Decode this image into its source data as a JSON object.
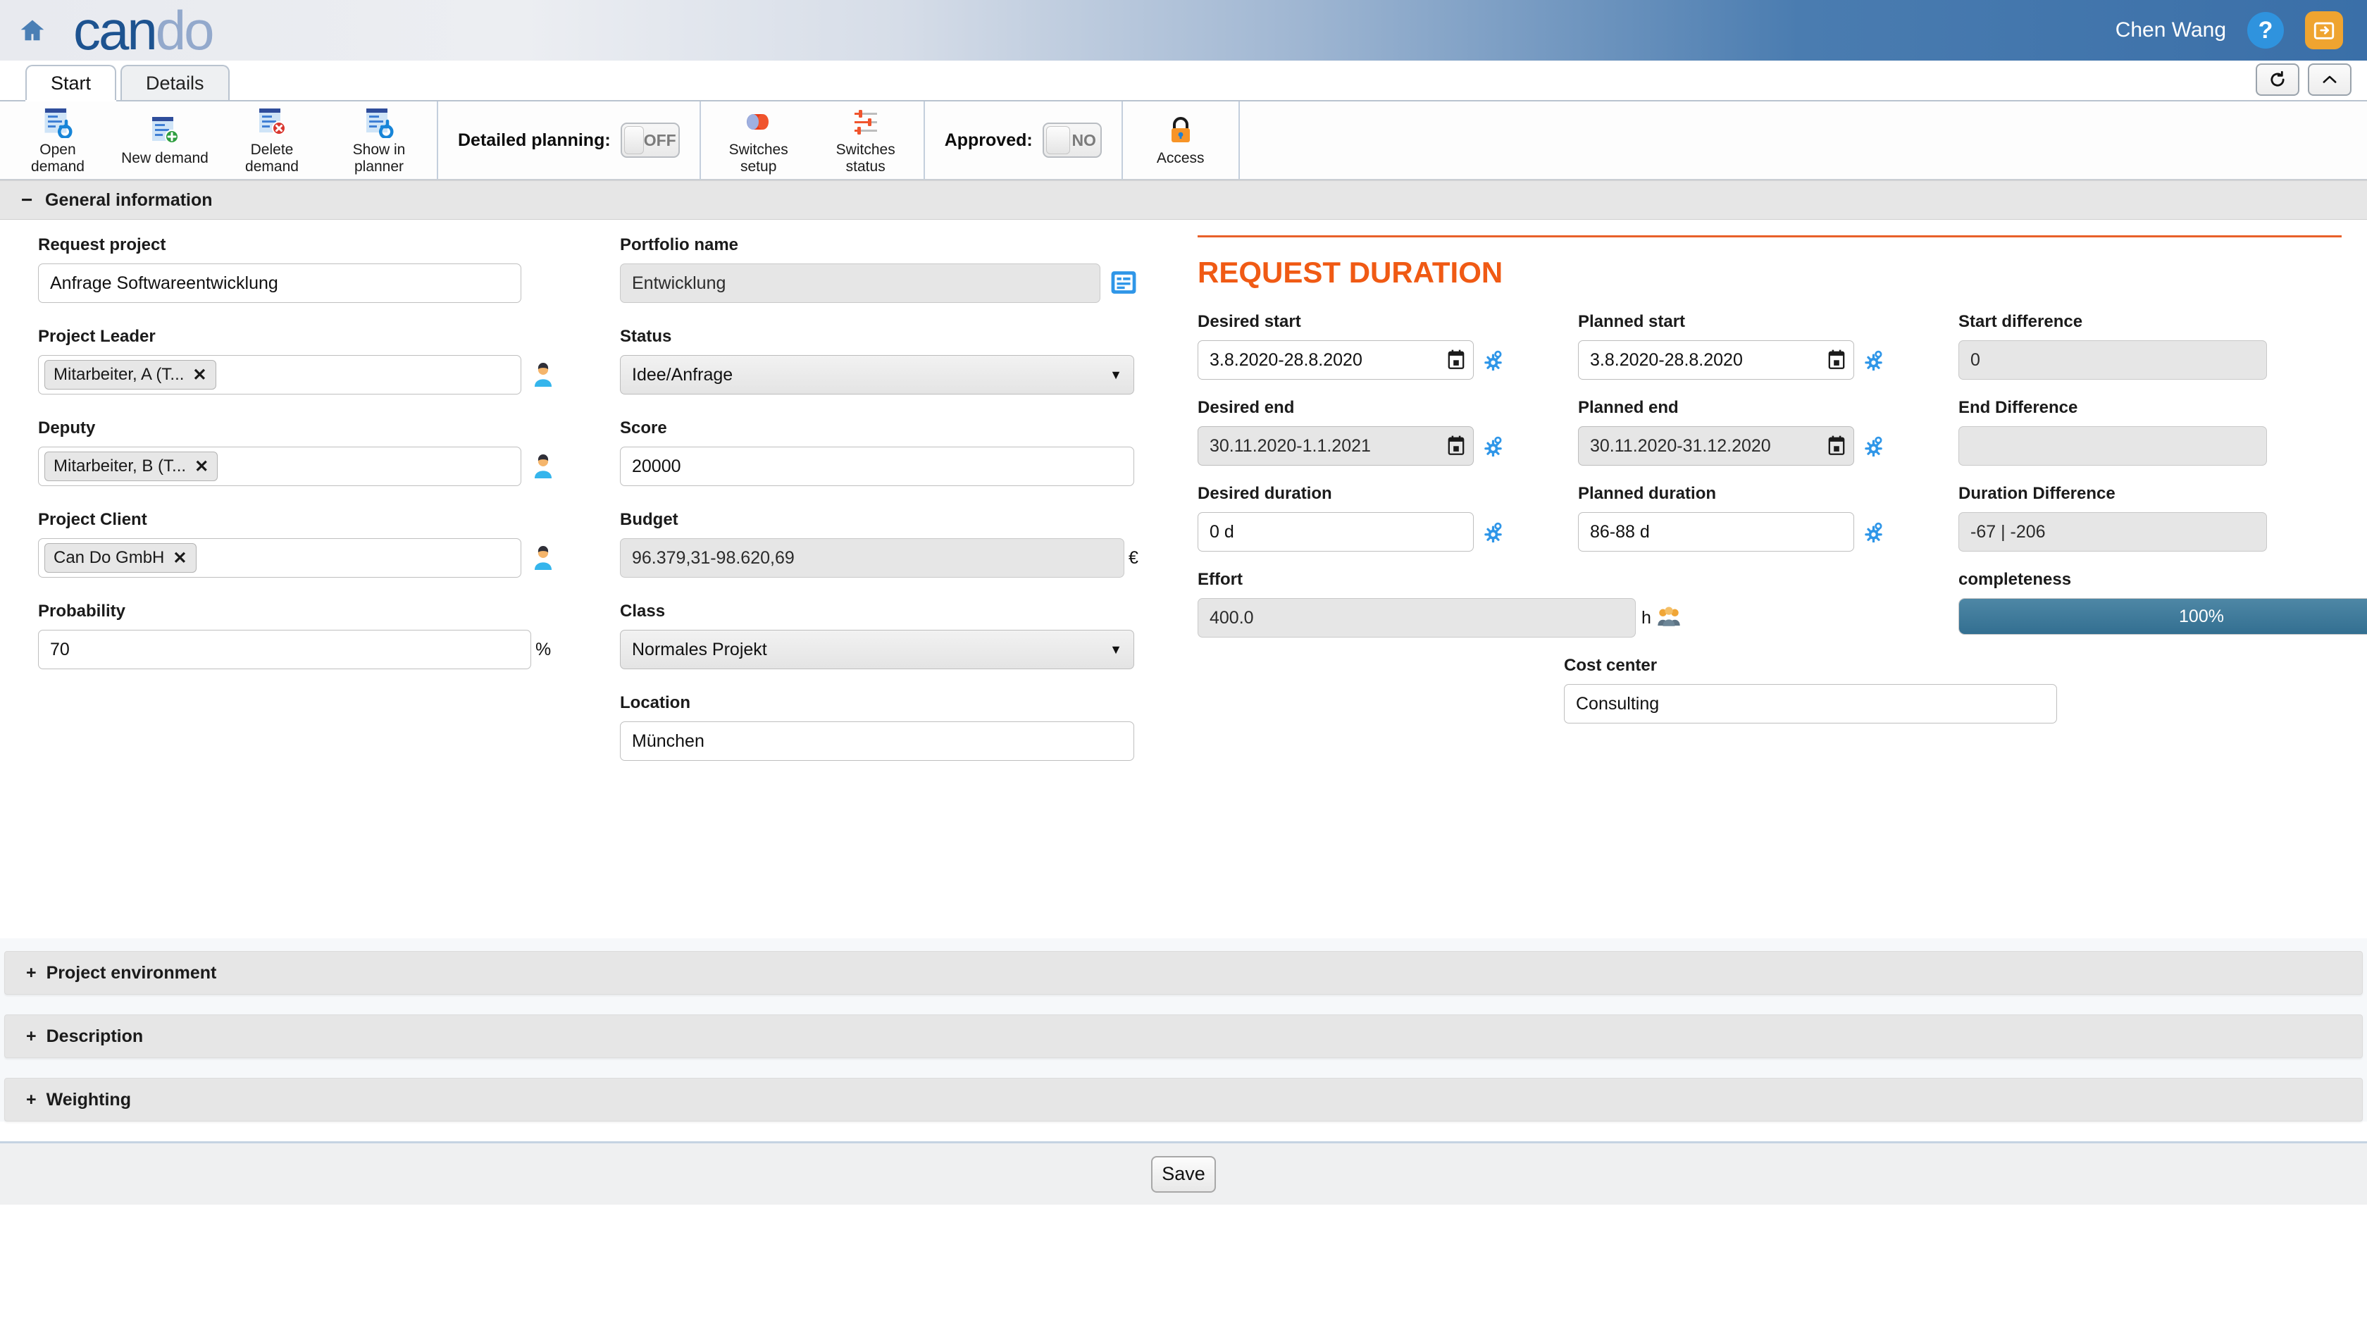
{
  "header": {
    "home_icon": "home-icon",
    "logo_first": "can",
    "logo_second": "do",
    "user_name": "Chen Wang",
    "help_label": "?",
    "help_icon": "question-mark-icon",
    "logout_icon": "logout-icon",
    "brand_blue": "#1d5390",
    "bar_blue": "#3a6fa8"
  },
  "tabs": {
    "items": [
      {
        "label": "Start",
        "active": true
      },
      {
        "label": "Details",
        "active": false
      }
    ],
    "refresh_icon": "refresh-icon",
    "collapse_icon": "chevron-up-icon"
  },
  "ribbon": {
    "commands": [
      {
        "label": "Open\ndemand",
        "line1": "Open",
        "line2": "demand",
        "icon": "open-demand-icon"
      },
      {
        "label": "New demand",
        "line1": "New demand",
        "line2": "",
        "icon": "new-demand-icon"
      },
      {
        "label": "Delete\ndemand",
        "line1": "Delete",
        "line2": "demand",
        "icon": "delete-demand-icon"
      },
      {
        "label": "Show in\nplanner",
        "line1": "Show in",
        "line2": "planner",
        "icon": "show-in-planner-icon"
      }
    ],
    "detailed_planning_label": "Detailed planning:",
    "detailed_planning_value": "OFF",
    "switches_setup": {
      "line1": "Switches",
      "line2": "setup",
      "icon": "switches-setup-icon"
    },
    "switches_status": {
      "line1": "Switches",
      "line2": "status",
      "icon": "switches-status-icon"
    },
    "approved_label": "Approved:",
    "approved_value": "NO",
    "access": {
      "label": "Access",
      "icon": "lock-icon"
    }
  },
  "general_section": {
    "title": "General information",
    "sign": "−"
  },
  "form": {
    "request_project": {
      "label": "Request project",
      "value": "Anfrage Softwareentwicklung"
    },
    "project_leader": {
      "label": "Project Leader",
      "chip": "Mitarbeiter, A (T...",
      "remove": "✕",
      "picker_icon": "person-picker-icon"
    },
    "deputy": {
      "label": "Deputy",
      "chip": "Mitarbeiter, B (T...",
      "remove": "✕",
      "picker_icon": "person-picker-icon"
    },
    "project_client": {
      "label": "Project Client",
      "chip": "Can Do GmbH",
      "remove": "✕",
      "picker_icon": "person-picker-icon"
    },
    "probability": {
      "label": "Probability",
      "value": "70",
      "suffix": "%"
    },
    "portfolio_name": {
      "label": "Portfolio name",
      "value": "Entwicklung",
      "icon": "portfolio-detail-icon"
    },
    "status": {
      "label": "Status",
      "value": "Idee/Anfrage",
      "caret": "▼"
    },
    "score": {
      "label": "Score",
      "value": "20000"
    },
    "budget": {
      "label": "Budget",
      "value": "96.379,31-98.620,69",
      "suffix": "€"
    },
    "class": {
      "label": "Class",
      "value": "Normales Projekt",
      "caret": "▼"
    },
    "location": {
      "label": "Location",
      "value": "München"
    }
  },
  "request_duration": {
    "title": "REQUEST DURATION",
    "accent": "#f05a14",
    "desired_start": {
      "label": "Desired start",
      "value": "3.8.2020-28.8.2020"
    },
    "planned_start": {
      "label": "Planned start",
      "value": "3.8.2020-28.8.2020"
    },
    "start_difference": {
      "label": "Start difference",
      "value": "0"
    },
    "desired_end": {
      "label": "Desired end",
      "value": "30.11.2020-1.1.2021"
    },
    "planned_end": {
      "label": "Planned end",
      "value": "30.11.2020-31.12.2020"
    },
    "end_difference": {
      "label": "End Difference",
      "value": ""
    },
    "desired_duration": {
      "label": "Desired duration",
      "value": "0 d"
    },
    "planned_duration": {
      "label": "Planned duration",
      "value": "86-88 d"
    },
    "duration_difference": {
      "label": "Duration Difference",
      "value": "-67 | -206"
    },
    "effort": {
      "label": "Effort",
      "value": "400.0",
      "suffix": "h",
      "icon": "team-icon"
    },
    "completeness": {
      "label": "completeness",
      "value": "100%",
      "percent": 100,
      "color": "#3c7a9c"
    },
    "cost_center": {
      "label": "Cost center",
      "value": "Consulting"
    },
    "calendar_icon": "calendar-icon",
    "gear_icon": "gear-icon"
  },
  "collapsed_sections": [
    {
      "label": "Project environment",
      "sign": "+"
    },
    {
      "label": "Description",
      "sign": "+"
    },
    {
      "label": "Weighting",
      "sign": "+"
    }
  ],
  "footer": {
    "save_label": "Save"
  }
}
